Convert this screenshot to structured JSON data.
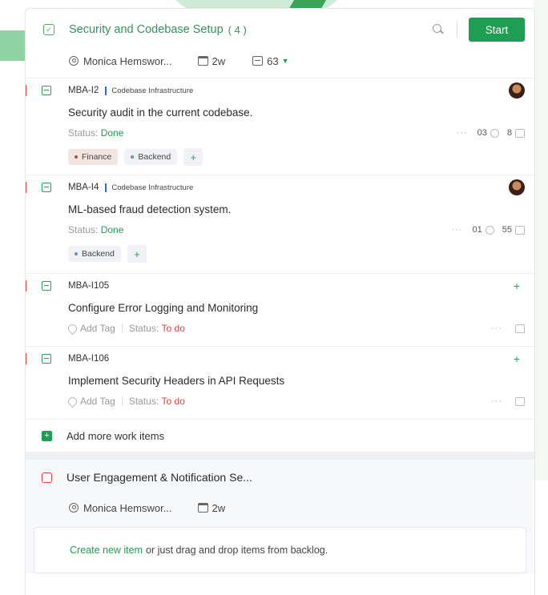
{
  "section1": {
    "title": "Security and Codebase Setup",
    "count": "( 4 )",
    "start_label": "Start",
    "assignee": "Monica Hemswor...",
    "duration": "2w",
    "points": "63"
  },
  "items": [
    {
      "id": "MBA-I2",
      "project": "Codebase Infrastructure",
      "title": "Security audit in the current codebase.",
      "status_label": "Status:",
      "status": "Done",
      "links": "03",
      "comments": "8",
      "tags": [
        "Finance",
        "Backend"
      ]
    },
    {
      "id": "MBA-I4",
      "project": "Codebase Infrastructure",
      "title": "ML-based fraud detection system.",
      "status_label": "Status:",
      "status": "Done",
      "links": "01",
      "comments": "55",
      "tags": [
        "Backend"
      ]
    },
    {
      "id": "MBA-I105",
      "title": "Configure Error Logging and Monitoring",
      "add_tag": "Add Tag",
      "status_label": "Status:",
      "status": "To do"
    },
    {
      "id": "MBA-I106",
      "title": "Implement Security Headers in API Requests",
      "add_tag": "Add Tag",
      "status_label": "Status:",
      "status": "To do"
    }
  ],
  "add_more_label": "Add more work items",
  "section2": {
    "title": "User Engagement & Notification Se...",
    "assignee": "Monica Hemswor...",
    "duration": "2w",
    "create_link": "Create new item",
    "drop_text": "or just drag and drop items from backlog."
  },
  "icons": {
    "plus": "+",
    "more": "···",
    "check": "✓",
    "caret": "▼"
  },
  "colors": {
    "accent": "#1f9d55",
    "done": "#1f9d55",
    "todo": "#d9463b",
    "infra_tag": "#2b6fd6"
  }
}
